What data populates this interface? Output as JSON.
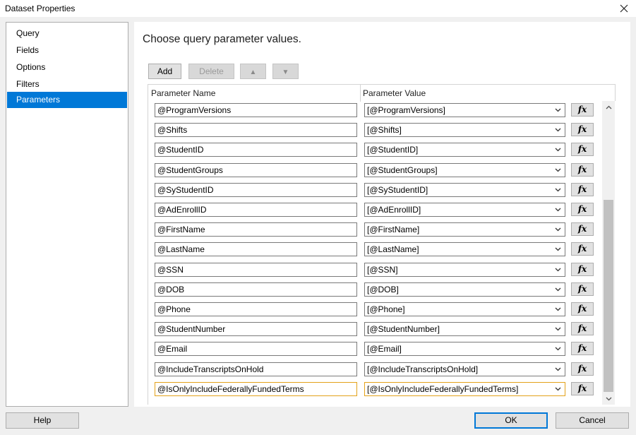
{
  "window": {
    "title": "Dataset Properties"
  },
  "nav": {
    "items": [
      {
        "label": "Query"
      },
      {
        "label": "Fields"
      },
      {
        "label": "Options"
      },
      {
        "label": "Filters"
      },
      {
        "label": "Parameters"
      }
    ],
    "selected": "Parameters"
  },
  "content": {
    "heading": "Choose query parameter values."
  },
  "toolbar": {
    "add_label": "Add",
    "delete_label": "Delete"
  },
  "grid": {
    "columns": {
      "name": "Parameter Name",
      "value": "Parameter Value"
    },
    "fx_label": "fx",
    "rows": [
      {
        "name": "@ProgramVersions",
        "value": "[@ProgramVersions]"
      },
      {
        "name": "@Shifts",
        "value": "[@Shifts]"
      },
      {
        "name": "@StudentID",
        "value": "[@StudentID]"
      },
      {
        "name": "@StudentGroups",
        "value": "[@StudentGroups]"
      },
      {
        "name": "@SyStudentID",
        "value": "[@SyStudentID]"
      },
      {
        "name": "@AdEnrollID",
        "value": "[@AdEnrollID]"
      },
      {
        "name": "@FirstName",
        "value": "[@FirstName]"
      },
      {
        "name": "@LastName",
        "value": "[@LastName]"
      },
      {
        "name": "@SSN",
        "value": "[@SSN]"
      },
      {
        "name": "@DOB",
        "value": "[@DOB]"
      },
      {
        "name": "@Phone",
        "value": "[@Phone]"
      },
      {
        "name": "@StudentNumber",
        "value": "[@StudentNumber]"
      },
      {
        "name": "@Email",
        "value": "[@Email]"
      },
      {
        "name": "@IncludeTranscriptsOnHold",
        "value": "[@IncludeTranscriptsOnHold]"
      },
      {
        "name": "@IsOnlyIncludeFederallyFundedTerms",
        "value": "[@IsOnlyIncludeFederallyFundedTerms]"
      }
    ]
  },
  "footer": {
    "help_label": "Help",
    "ok_label": "OK",
    "cancel_label": "Cancel"
  },
  "colors": {
    "accent": "#0078d7",
    "focus_border": "#e3a21a"
  }
}
